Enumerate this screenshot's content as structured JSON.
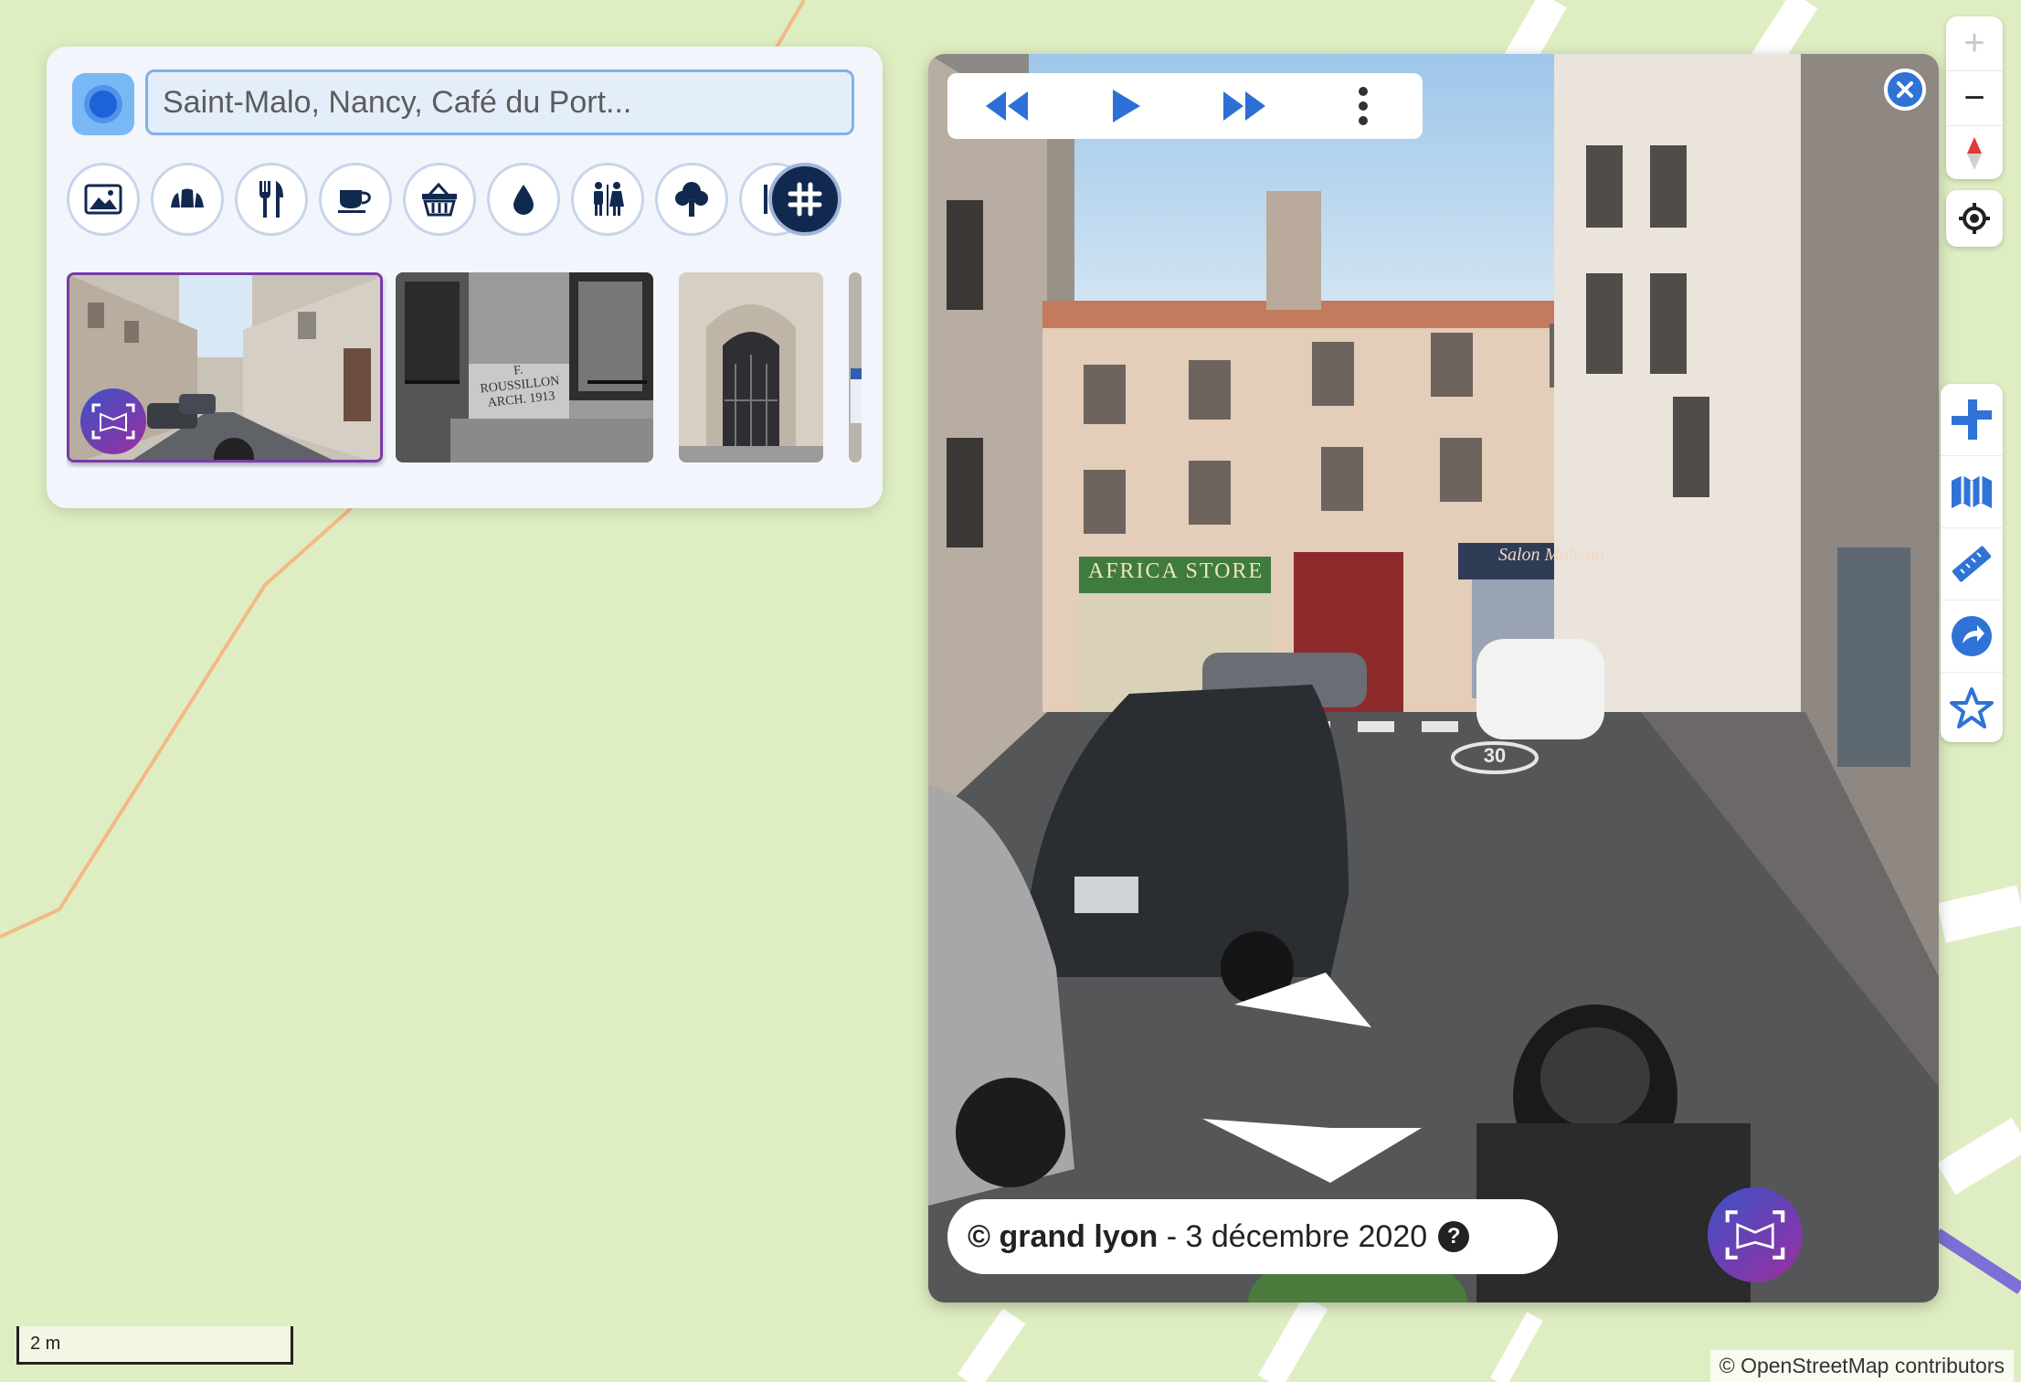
{
  "search": {
    "placeholder": "Saint-Malo, Nancy, Café du Port..."
  },
  "categories": [
    {
      "icon": "picture-icon"
    },
    {
      "icon": "pastry-icon"
    },
    {
      "icon": "restaurant-icon"
    },
    {
      "icon": "cafe-icon"
    },
    {
      "icon": "shopping-basket-icon"
    },
    {
      "icon": "water-icon"
    },
    {
      "icon": "toilets-icon"
    },
    {
      "icon": "tree-icon"
    },
    {
      "icon": "pharmacy-icon"
    },
    {
      "icon": "more-categories-icon"
    }
  ],
  "thumbnails": [
    {
      "kind": "street-panorama",
      "selected": true
    },
    {
      "kind": "building-facade",
      "text": "F. ROUSSILLON ARCH. 1913"
    },
    {
      "kind": "doorway"
    },
    {
      "kind": "sign"
    }
  ],
  "viewer": {
    "credit_source": "© grand lyon",
    "credit_date": "3 décembre 2020",
    "help_label": "?",
    "shop_signs": [
      "AFRICA STORE",
      "Salon Mahena"
    ],
    "road_marking": "30"
  },
  "zoom": {
    "in_label": "+",
    "out_label": "−"
  },
  "tools": [
    {
      "icon": "directions-icon"
    },
    {
      "icon": "map-layers-icon"
    },
    {
      "icon": "ruler-icon"
    },
    {
      "icon": "share-icon"
    },
    {
      "icon": "star-icon"
    }
  ],
  "scale_label": "2 m",
  "attribution": "© OpenStreetMap contributors",
  "colors": {
    "map_background": "#dfeec2",
    "accent_blue": "#2f73d6",
    "dark_navy": "#12294f",
    "panorama_badge_start": "#3b52c7",
    "panorama_badge_end": "#9b2fa0"
  }
}
